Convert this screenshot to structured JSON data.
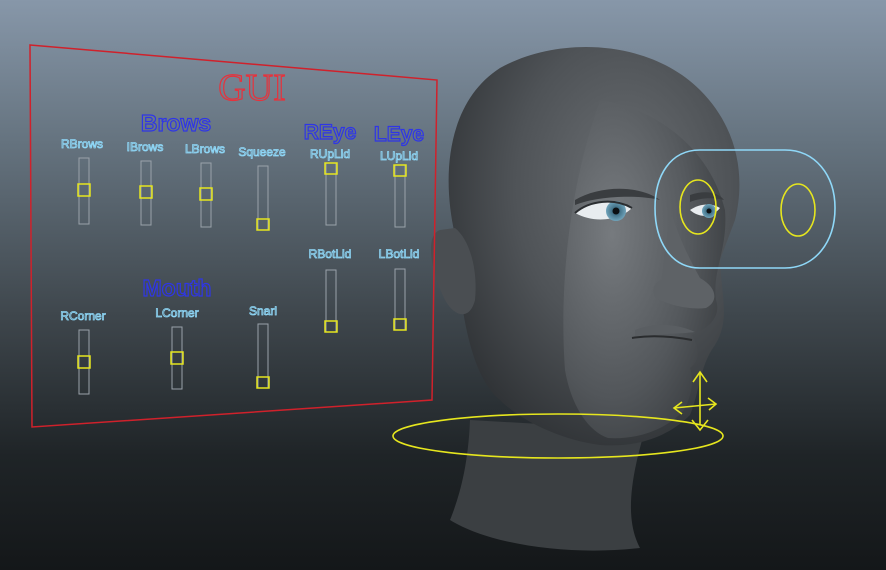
{
  "gui_panel": {
    "title": "GUI",
    "sections": {
      "brows": "Brows",
      "reye": "REye",
      "leye": "LEye",
      "mouth": "Mouth"
    },
    "sliders": [
      {
        "id": "rbrows",
        "label": "RBrows",
        "value": 0.5
      },
      {
        "id": "ibrows",
        "label": "IBrows",
        "value": 0.5
      },
      {
        "id": "lbrows",
        "label": "LBrows",
        "value": 0.5
      },
      {
        "id": "squeeze",
        "label": "Squeeze",
        "value": 0.0
      },
      {
        "id": "ruplid",
        "label": "RUpLid",
        "value": 1.0
      },
      {
        "id": "luplid",
        "label": "LUpLid",
        "value": 1.0
      },
      {
        "id": "rbotlid",
        "label": "RBotLid",
        "value": 0.0
      },
      {
        "id": "lbotlid",
        "label": "LBotLid",
        "value": 0.0
      },
      {
        "id": "rcorner",
        "label": "RCorner",
        "value": 0.5
      },
      {
        "id": "lcorner",
        "label": "LCorner",
        "value": 0.5
      },
      {
        "id": "snarl",
        "label": "Snarl",
        "value": 0.0
      }
    ]
  },
  "colors": {
    "panel_border": "#d0212b",
    "title": "#e6323c",
    "section": "#2f36e6",
    "slider_label": "#8fd8f8",
    "slider_track": "#9aa2aa",
    "slider_handle": "#e6e61e",
    "eye_ring": "#8fd8f8",
    "control": "#e6e61e",
    "head": "#505457"
  }
}
